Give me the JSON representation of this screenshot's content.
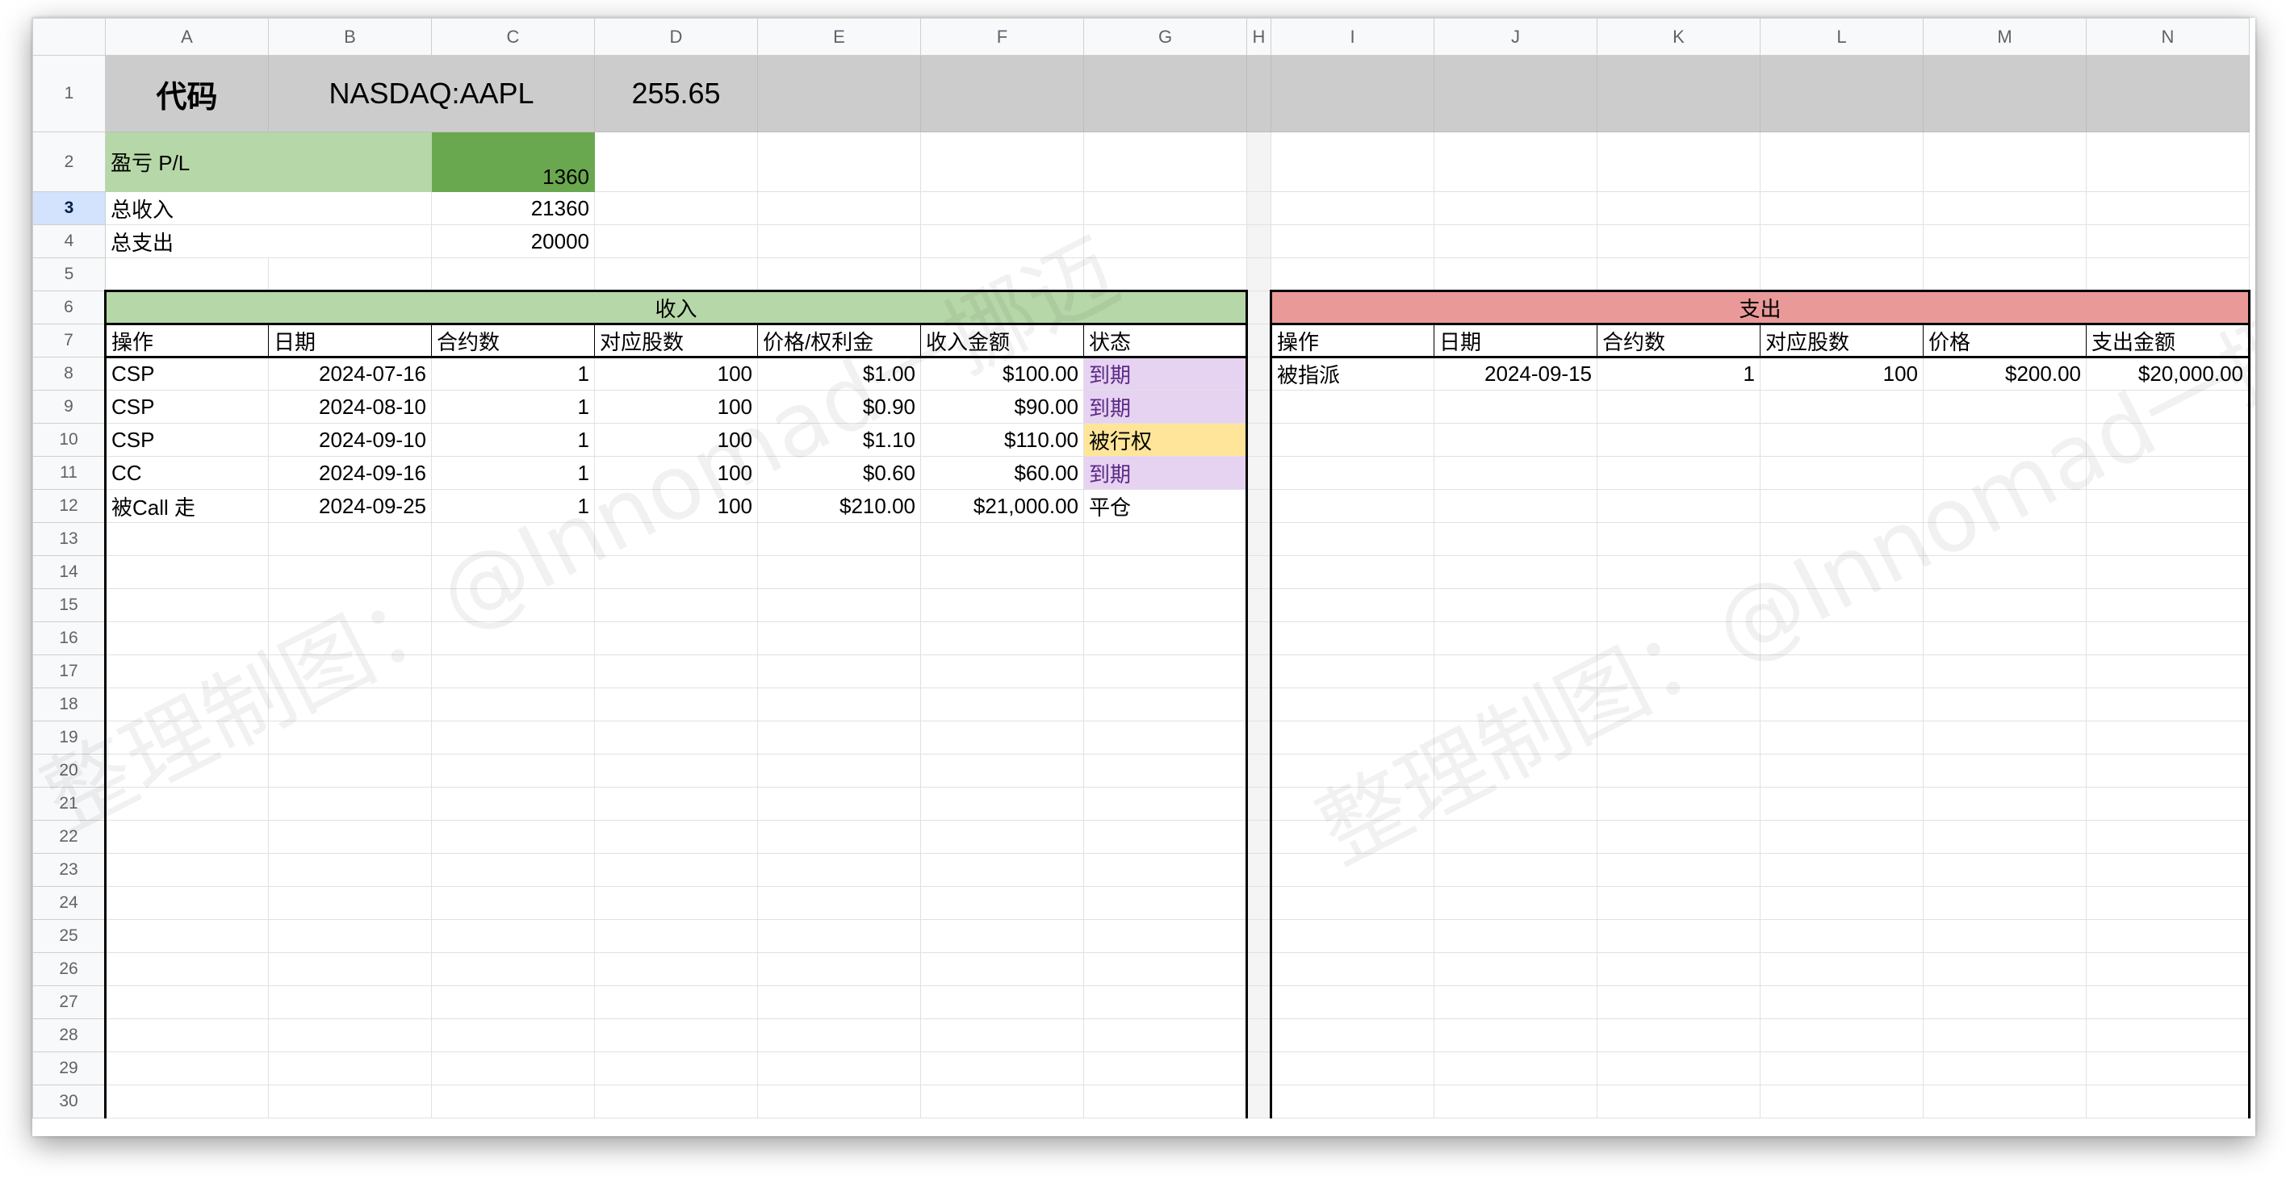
{
  "columns": [
    "A",
    "B",
    "C",
    "D",
    "E",
    "F",
    "G",
    "H",
    "I",
    "J",
    "K",
    "L",
    "M",
    "N"
  ],
  "row_numbers": [
    "1",
    "2",
    "3",
    "4",
    "5",
    "6",
    "7",
    "8",
    "9",
    "10",
    "11",
    "12",
    "13",
    "14",
    "15",
    "16",
    "17",
    "18",
    "19",
    "20",
    "21",
    "22",
    "23",
    "24",
    "25",
    "26",
    "27",
    "28",
    "29",
    "30"
  ],
  "selected_row": "3",
  "summary": {
    "code_label": "代码",
    "ticker": "NASDAQ:AAPL",
    "price": "255.65",
    "pl_label": "盈亏 P/L",
    "pl_value": "1360",
    "total_income_label": "总收入",
    "total_income": "21360",
    "total_expense_label": "总支出",
    "total_expense": "20000"
  },
  "income": {
    "title": "收入",
    "headers": [
      "操作",
      "日期",
      "合约数",
      "对应股数",
      "价格/权利金",
      "收入金额",
      "状态"
    ],
    "rows": [
      {
        "action": "CSP",
        "date": "2024-07-16",
        "contracts": "1",
        "shares": "100",
        "price": "$1.00",
        "amount": "$100.00",
        "status": "到期",
        "status_type": "expired"
      },
      {
        "action": "CSP",
        "date": "2024-08-10",
        "contracts": "1",
        "shares": "100",
        "price": "$0.90",
        "amount": "$90.00",
        "status": "到期",
        "status_type": "expired"
      },
      {
        "action": "CSP",
        "date": "2024-09-10",
        "contracts": "1",
        "shares": "100",
        "price": "$1.10",
        "amount": "$110.00",
        "status": "被行权",
        "status_type": "assigned"
      },
      {
        "action": "CC",
        "date": "2024-09-16",
        "contracts": "1",
        "shares": "100",
        "price": "$0.60",
        "amount": "$60.00",
        "status": "到期",
        "status_type": "expired"
      },
      {
        "action": "被Call 走",
        "date": "2024-09-25",
        "contracts": "1",
        "shares": "100",
        "price": "$210.00",
        "amount": "$21,000.00",
        "status": "平仓",
        "status_type": "closed"
      }
    ]
  },
  "expense": {
    "title": "支出",
    "headers": [
      "操作",
      "日期",
      "合约数",
      "对应股数",
      "价格",
      "支出金额"
    ],
    "rows": [
      {
        "action": "被指派",
        "date": "2024-09-15",
        "contracts": "1",
        "shares": "100",
        "price": "$200.00",
        "amount": "$20,000.00"
      }
    ]
  },
  "watermark": [
    "整理制图：@Innomad一挪迈",
    "整理制图：@Innomad一挪迈"
  ],
  "colors": {
    "header_gray": "#cccccc",
    "light_green": "#b6d7a8",
    "dark_green": "#6aa84f",
    "expense_red": "#ea9999",
    "expired_purple": "#e6d2f1",
    "assigned_yellow": "#ffe599"
  }
}
